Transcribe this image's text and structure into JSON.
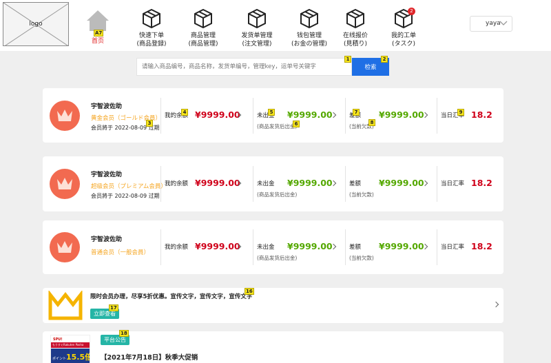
{
  "logo": {
    "text": "logo"
  },
  "nav": {
    "home": {
      "label": "首页",
      "badge": "A7"
    },
    "items": [
      {
        "line1": "快速下单",
        "line2": "(商品登録)",
        "icon": "box-icon"
      },
      {
        "line1": "商品管理",
        "line2": "(商品管理)",
        "icon": "box-icon"
      },
      {
        "line1": "发货单管理",
        "line2": "(注文管理)",
        "icon": "box-icon"
      },
      {
        "line1": "钱包管理",
        "line2": "(お金の管理)",
        "icon": "box-icon"
      },
      {
        "line1": "在线报价",
        "line2": "(見積り)",
        "icon": "box-icon"
      },
      {
        "line1": "我的工单",
        "line2": "(タスク)",
        "icon": "box-icon",
        "badge": "2"
      }
    ]
  },
  "user": {
    "name": "yaya"
  },
  "search": {
    "placeholder": "请输入商品编号，商品名称，发货单编号，管理key，运单号关键字",
    "button": "检索",
    "marker_input": "1",
    "marker_button": "2"
  },
  "cards": [
    {
      "name": "宇智波佐助",
      "level": "黄金会员（ゴールド会員）",
      "expire": "会员將于 2022-08-09 过期",
      "balance_label": "我的余额",
      "balance": "¥9999.00",
      "unshipped_label": "未出金",
      "unshipped": "¥9999.00",
      "unshipped_sub": "(商品发货后出金)",
      "diff_label": "差额",
      "diff": "¥9999.00",
      "diff_sub": "(当前欠款)",
      "rate_label": "当日汇率",
      "rate": "18.2",
      "markers": {
        "level": "3",
        "balance": "4",
        "unshipped": "5",
        "unshipped_sub": "6",
        "diff": "7",
        "diff_sub": "8",
        "rate": "9"
      }
    },
    {
      "name": "宇智波佐助",
      "level": "超级会员（プレミアム会員）",
      "expire": "会员將于 2022-08-09 过期",
      "balance_label": "我的余额",
      "balance": "¥9999.00",
      "unshipped_label": "未出金",
      "unshipped": "¥9999.00",
      "unshipped_sub": "(商品发货后出金)",
      "diff_label": "差额",
      "diff": "¥9999.00",
      "diff_sub": "(当前欠款)",
      "rate_label": "当日汇率",
      "rate": "18.2"
    },
    {
      "name": "宇智波佐助",
      "level": "普通会员（一般会員）",
      "expire": "",
      "balance_label": "我的余额",
      "balance": "¥9999.00",
      "unshipped_label": "未出金",
      "unshipped": "¥9999.00",
      "unshipped_sub": "(商品发货后出金)",
      "diff_label": "差额",
      "diff": "¥9999.00",
      "diff_sub": "(当前欠款)",
      "rate_label": "当日汇率",
      "rate": "18.2"
    }
  ],
  "promo": {
    "text": "限时会员办理，尽享5折优惠。宣传文字，宣传文字，宣传文字",
    "button": "立即查看",
    "marker_text": "16",
    "marker_button": "17"
  },
  "notice": {
    "badge": "平台公告",
    "marker": "18",
    "title": "【2021年7月18日】秋季大促销",
    "img_text_top": "SPU!",
    "img_text_mid": "もうすぐRakuten Pasha",
    "img_text_big": "15.5倍",
    "img_text_small": "ポイント"
  },
  "colors": {
    "price_red": "#d0021b",
    "price_green": "#54a800",
    "accent_blue": "#1f6fe5",
    "gold": "#f5a623",
    "teal": "#25b5a6",
    "crown_bg": "#f26a50"
  }
}
